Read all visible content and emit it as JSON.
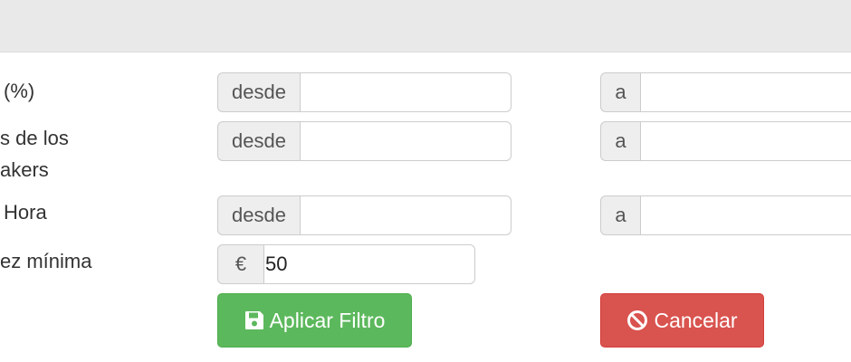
{
  "rows": [
    {
      "label": "(%)",
      "from_addon": "desde",
      "from_value": "",
      "to_addon": "a",
      "to_value": ""
    },
    {
      "label_line1": "s de los",
      "label_line2": "akers",
      "from_addon": "desde",
      "from_value": "",
      "to_addon": "a",
      "to_value": ""
    },
    {
      "label": "Hora",
      "from_addon": "desde",
      "from_value": "",
      "to_addon": "a",
      "to_value": ""
    },
    {
      "label": "ez mínima",
      "currency_addon": "€",
      "value": "50"
    }
  ],
  "buttons": {
    "apply_label": "Aplicar Filtro",
    "cancel_label": "Cancelar",
    "apply_icon": "floppy-disk-icon",
    "cancel_icon": "ban-icon"
  },
  "colors": {
    "apply": "#5cb85c",
    "cancel": "#d9534f",
    "header": "#e9e9e9"
  }
}
